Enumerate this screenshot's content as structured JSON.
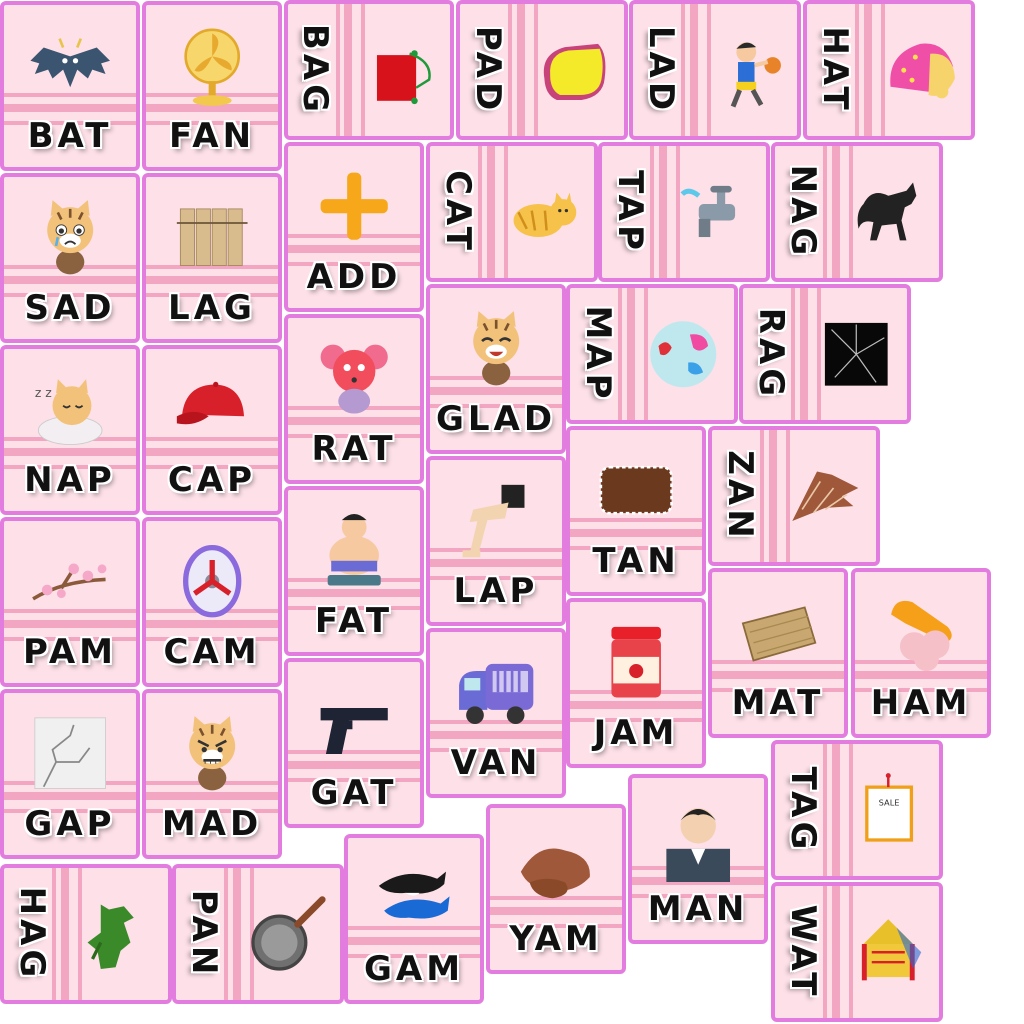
{
  "cards": [
    {
      "word": "BAT",
      "icon": "bat-icon"
    },
    {
      "word": "FAN",
      "icon": "fan-icon"
    },
    {
      "word": "BAG",
      "icon": "bag-icon"
    },
    {
      "word": "PAD",
      "icon": "pad-icon"
    },
    {
      "word": "LAD",
      "icon": "lad-icon"
    },
    {
      "word": "HAT",
      "icon": "hat-icon"
    },
    {
      "word": "SAD",
      "icon": "sad-cat-icon"
    },
    {
      "word": "LAG",
      "icon": "lag-boards-icon"
    },
    {
      "word": "ADD",
      "icon": "plus-icon"
    },
    {
      "word": "CAT",
      "icon": "cat-icon"
    },
    {
      "word": "TAP",
      "icon": "tap-icon"
    },
    {
      "word": "NAG",
      "icon": "horse-icon"
    },
    {
      "word": "NAP",
      "icon": "napping-cat-icon"
    },
    {
      "word": "CAP",
      "icon": "cap-icon"
    },
    {
      "word": "RAT",
      "icon": "rat-icon"
    },
    {
      "word": "GLAD",
      "icon": "glad-cat-icon"
    },
    {
      "word": "MAP",
      "icon": "globe-icon"
    },
    {
      "word": "RAG",
      "icon": "rag-icon"
    },
    {
      "word": "PAM",
      "icon": "blossom-branch-icon"
    },
    {
      "word": "CAM",
      "icon": "cam-icon"
    },
    {
      "word": "FAT",
      "icon": "fat-man-icon"
    },
    {
      "word": "LAP",
      "icon": "lap-icon"
    },
    {
      "word": "TAN",
      "icon": "tan-biscuit-icon"
    },
    {
      "word": "ZAN",
      "icon": "zan-icon"
    },
    {
      "word": "GAP",
      "icon": "cracked-wall-icon"
    },
    {
      "word": "MAD",
      "icon": "mad-cat-icon"
    },
    {
      "word": "GAT",
      "icon": "gun-icon"
    },
    {
      "word": "VAN",
      "icon": "van-icon"
    },
    {
      "word": "JAM",
      "icon": "jam-jar-icon"
    },
    {
      "word": "MAT",
      "icon": "mat-icon"
    },
    {
      "word": "HAM",
      "icon": "ham-icon"
    },
    {
      "word": "TAG",
      "icon": "sale-tag-icon"
    },
    {
      "word": "HAG",
      "icon": "hag-icon"
    },
    {
      "word": "PAN",
      "icon": "frying-pan-icon"
    },
    {
      "word": "GAM",
      "icon": "dolphins-icon"
    },
    {
      "word": "YAM",
      "icon": "yam-icon"
    },
    {
      "word": "MAN",
      "icon": "man-icon"
    },
    {
      "word": "WAT",
      "icon": "temple-icon"
    }
  ],
  "tag_label": "SALE",
  "colors": {
    "card": "#fde0e8",
    "border": "#e27ddf",
    "band": "#f3a6c1"
  }
}
